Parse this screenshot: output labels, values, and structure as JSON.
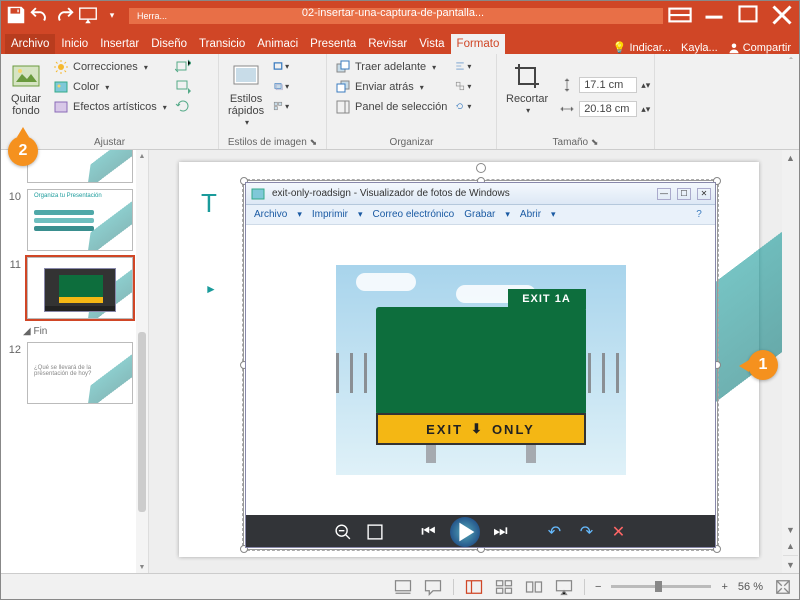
{
  "titlebar": {
    "filename": "02-insertar-una-captura-de-pantalla...",
    "context_tab": "Herra...",
    "user": "Kayla...",
    "share": "Compartir",
    "indicator": "Indicar..."
  },
  "menu": {
    "file": "Archivo",
    "tabs": [
      "Inicio",
      "Insertar",
      "Diseño",
      "Transicio",
      "Animaci",
      "Presenta",
      "Revisar",
      "Vista",
      "Formato"
    ],
    "active": "Formato"
  },
  "ribbon": {
    "adjust": {
      "remove_bg": "Quitar\nfondo",
      "corrections": "Correcciones",
      "color": "Color",
      "artistic": "Efectos artísticos",
      "label": "Ajustar"
    },
    "styles": {
      "quick_styles": "Estilos\nrápidos",
      "label": "Estilos de imagen"
    },
    "arrange": {
      "bring_forward": "Traer adelante",
      "send_back": "Enviar atrás",
      "selection_pane": "Panel de selección",
      "label": "Organizar"
    },
    "size": {
      "crop": "Recortar",
      "height": "17.1 cm",
      "width": "20.18 cm",
      "label": "Tamaño"
    }
  },
  "thumbnails": {
    "items": [
      {
        "num": "",
        "title_short": ""
      },
      {
        "num": "10",
        "title_short": "Organiza tu Presentación"
      },
      {
        "num": "11"
      },
      {
        "num": "12",
        "title_short": "¿Qué se llevará de la presentación de hoy?"
      }
    ],
    "section": "Fin"
  },
  "photo_viewer": {
    "title": "exit-only-roadsign - Visualizador de fotos de Windows",
    "menu": [
      "Archivo",
      "Imprimir",
      "Correo electrónico",
      "Grabar",
      "Abrir"
    ],
    "sign_tab": "EXIT 1A",
    "sign_exit": "EXIT",
    "sign_only": "ONLY"
  },
  "slide": {
    "title_letter": "T",
    "bullet": "►"
  },
  "callouts": {
    "one": "1",
    "two": "2"
  },
  "status": {
    "zoom": "56 %"
  }
}
